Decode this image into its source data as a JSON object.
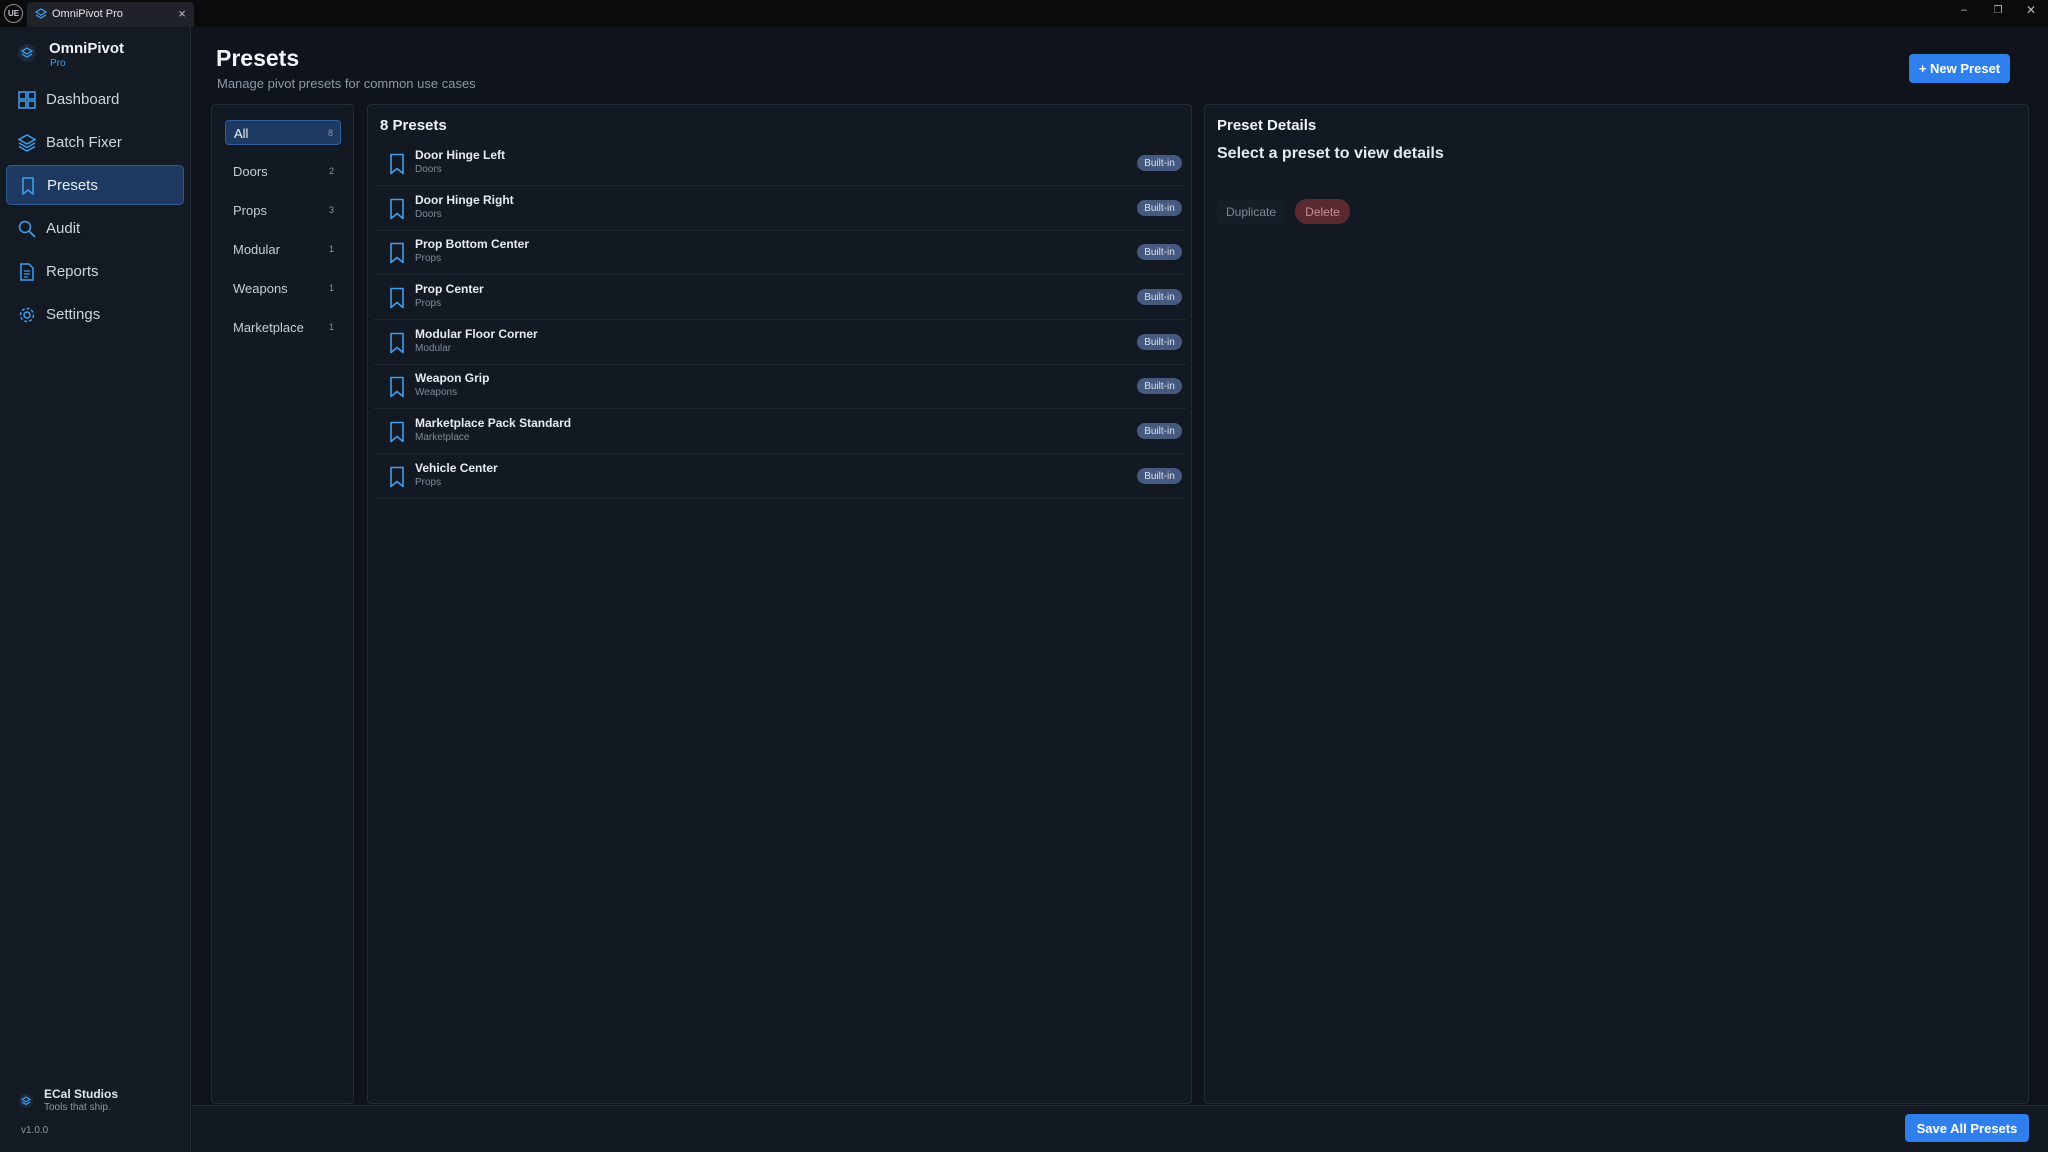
{
  "titlebar": {
    "logo_text": "UE",
    "tab_label": "OmniPivot Pro",
    "tab_close": "×",
    "minimize": "–",
    "restore": "❐",
    "close": "✕"
  },
  "brand": {
    "name": "OmniPivot",
    "sub": "Pro",
    "accent": "#3f9ff0"
  },
  "nav": [
    {
      "label": "Dashboard",
      "icon": "dashboard-grid-icon",
      "active": false
    },
    {
      "label": "Batch Fixer",
      "icon": "layers-icon",
      "active": false
    },
    {
      "label": "Presets",
      "icon": "bookmark-icon",
      "active": true
    },
    {
      "label": "Audit",
      "icon": "search-icon",
      "active": false
    },
    {
      "label": "Reports",
      "icon": "report-document-icon",
      "active": false
    },
    {
      "label": "Settings",
      "icon": "gear-icon",
      "active": false
    }
  ],
  "studio": {
    "name": "ECal Studios",
    "tagline": "Tools that ship.",
    "version": "v1.0.0"
  },
  "header": {
    "title": "Presets",
    "subtitle": "Manage pivot presets for common use cases",
    "new_button": "+ New Preset"
  },
  "categories": [
    {
      "label": "All",
      "count": "8",
      "active": true
    },
    {
      "label": "Doors",
      "count": "2",
      "active": false
    },
    {
      "label": "Props",
      "count": "3",
      "active": false
    },
    {
      "label": "Modular",
      "count": "1",
      "active": false
    },
    {
      "label": "Weapons",
      "count": "1",
      "active": false
    },
    {
      "label": "Marketplace",
      "count": "1",
      "active": false
    }
  ],
  "list": {
    "title": "8 Presets",
    "items": [
      {
        "name": "Door Hinge Left",
        "category": "Doors",
        "badge": "Built-in"
      },
      {
        "name": "Door Hinge Right",
        "category": "Doors",
        "badge": "Built-in"
      },
      {
        "name": "Prop Bottom Center",
        "category": "Props",
        "badge": "Built-in"
      },
      {
        "name": "Prop Center",
        "category": "Props",
        "badge": "Built-in"
      },
      {
        "name": "Modular Floor Corner",
        "category": "Modular",
        "badge": "Built-in"
      },
      {
        "name": "Weapon Grip",
        "category": "Weapons",
        "badge": "Built-in"
      },
      {
        "name": "Marketplace Pack Standard",
        "category": "Marketplace",
        "badge": "Built-in"
      },
      {
        "name": "Vehicle Center",
        "category": "Props",
        "badge": "Built-in"
      }
    ]
  },
  "details": {
    "title": "Preset Details",
    "empty_message": "Select a preset to view details",
    "duplicate_label": "Duplicate",
    "delete_label": "Delete"
  },
  "footer": {
    "save_all": "Save All Presets"
  },
  "colors": {
    "primary": "#2f80ed",
    "badge": "#46597f",
    "danger": "#5a2a30",
    "icon_accent": "#3f9ff0"
  }
}
